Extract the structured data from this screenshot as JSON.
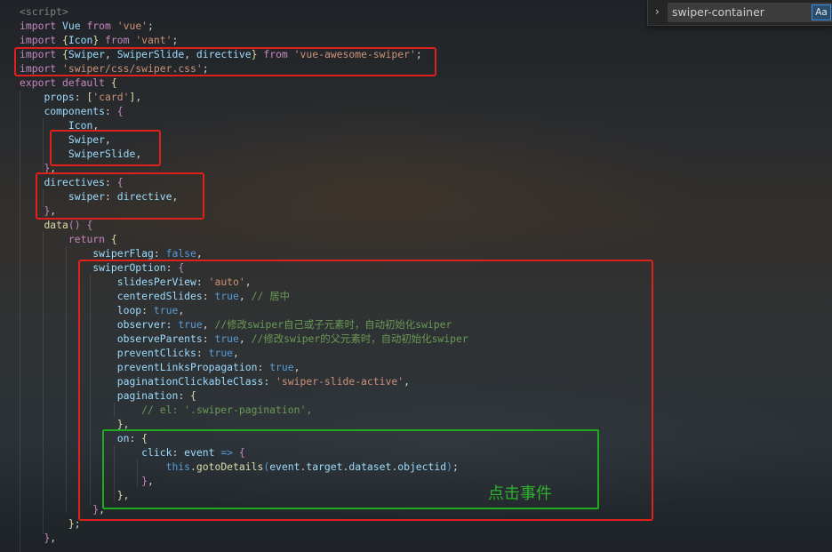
{
  "code_lines": [
    [
      [
        "tag",
        "<script>"
      ]
    ],
    [
      [
        "kw",
        "import "
      ],
      [
        "id",
        "Vue "
      ],
      [
        "kw",
        "from "
      ],
      [
        "str",
        "'vue'"
      ],
      [
        "punc",
        ";"
      ]
    ],
    [
      [
        "kw",
        "import "
      ],
      [
        "fn",
        "{"
      ],
      [
        "id",
        "Icon"
      ],
      [
        "fn",
        "} "
      ],
      [
        "kw",
        "from "
      ],
      [
        "str",
        "'vant'"
      ],
      [
        "punc",
        ";"
      ]
    ],
    [
      [
        "kw",
        "import "
      ],
      [
        "fn",
        "{"
      ],
      [
        "id",
        "Swiper"
      ],
      [
        "punc",
        ", "
      ],
      [
        "id",
        "SwiperSlide"
      ],
      [
        "punc",
        ", "
      ],
      [
        "id",
        "directive"
      ],
      [
        "fn",
        "} "
      ],
      [
        "kw",
        "from "
      ],
      [
        "str",
        "'vue-awesome-swiper'"
      ],
      [
        "punc",
        ";"
      ]
    ],
    [
      [
        "kw",
        "import "
      ],
      [
        "str",
        "'swiper/css/swiper.css'"
      ],
      [
        "punc",
        ";"
      ]
    ],
    [
      [
        "kw",
        "export default "
      ],
      [
        "fn",
        "{"
      ]
    ],
    [
      [
        "punc",
        "    "
      ],
      [
        "id",
        "props"
      ],
      [
        "punc",
        ": "
      ],
      [
        "fn",
        "["
      ],
      [
        "str",
        "'card'"
      ],
      [
        "fn",
        "]"
      ],
      [
        "punc",
        ","
      ]
    ],
    [
      [
        "punc",
        "    "
      ],
      [
        "id",
        "components"
      ],
      [
        "punc",
        ": "
      ],
      [
        "kw",
        "{"
      ]
    ],
    [
      [
        "punc",
        "        "
      ],
      [
        "id",
        "Icon"
      ],
      [
        "punc",
        ","
      ]
    ],
    [
      [
        "punc",
        "        "
      ],
      [
        "id",
        "Swiper"
      ],
      [
        "punc",
        ","
      ]
    ],
    [
      [
        "punc",
        "        "
      ],
      [
        "id",
        "SwiperSlide"
      ],
      [
        "punc",
        ","
      ]
    ],
    [
      [
        "punc",
        "    "
      ],
      [
        "kw",
        "}"
      ],
      [
        "punc",
        ","
      ]
    ],
    [
      [
        "punc",
        "    "
      ],
      [
        "id",
        "directives"
      ],
      [
        "punc",
        ": "
      ],
      [
        "kw",
        "{"
      ]
    ],
    [
      [
        "punc",
        "        "
      ],
      [
        "id",
        "swiper"
      ],
      [
        "punc",
        ": "
      ],
      [
        "id",
        "directive"
      ],
      [
        "punc",
        ","
      ]
    ],
    [
      [
        "punc",
        "    "
      ],
      [
        "kw",
        "}"
      ],
      [
        "punc",
        ","
      ]
    ],
    [
      [
        "punc",
        "    "
      ],
      [
        "fn",
        "data"
      ],
      [
        "kw",
        "() {"
      ]
    ],
    [
      [
        "punc",
        "        "
      ],
      [
        "kw",
        "return "
      ],
      [
        "fn",
        "{"
      ]
    ],
    [
      [
        "punc",
        "            "
      ],
      [
        "id",
        "swiperFlag"
      ],
      [
        "punc",
        ": "
      ],
      [
        "kw2",
        "false"
      ],
      [
        "punc",
        ","
      ]
    ],
    [
      [
        "punc",
        "            "
      ],
      [
        "id",
        "swiperOption"
      ],
      [
        "punc",
        ": "
      ],
      [
        "kw",
        "{"
      ]
    ],
    [
      [
        "punc",
        "                "
      ],
      [
        "id",
        "slidesPerView"
      ],
      [
        "punc",
        ": "
      ],
      [
        "str",
        "'auto'"
      ],
      [
        "punc",
        ","
      ]
    ],
    [
      [
        "punc",
        "                "
      ],
      [
        "id",
        "centeredSlides"
      ],
      [
        "punc",
        ": "
      ],
      [
        "kw2",
        "true"
      ],
      [
        "punc",
        ", "
      ],
      [
        "cm",
        "// 居中"
      ]
    ],
    [
      [
        "punc",
        "                "
      ],
      [
        "id",
        "loop"
      ],
      [
        "punc",
        ": "
      ],
      [
        "kw2",
        "true"
      ],
      [
        "punc",
        ","
      ]
    ],
    [
      [
        "punc",
        "                "
      ],
      [
        "id",
        "observer"
      ],
      [
        "punc",
        ": "
      ],
      [
        "kw2",
        "true"
      ],
      [
        "punc",
        ", "
      ],
      [
        "cm",
        "//修改swiper自己或子元素时，自动初始化swiper"
      ]
    ],
    [
      [
        "punc",
        "                "
      ],
      [
        "id",
        "observeParents"
      ],
      [
        "punc",
        ": "
      ],
      [
        "kw2",
        "true"
      ],
      [
        "punc",
        ", "
      ],
      [
        "cm",
        "//修改swiper的父元素时，自动初始化swiper"
      ]
    ],
    [
      [
        "punc",
        "                "
      ],
      [
        "id",
        "preventClicks"
      ],
      [
        "punc",
        ": "
      ],
      [
        "kw2",
        "true"
      ],
      [
        "punc",
        ","
      ]
    ],
    [
      [
        "punc",
        "                "
      ],
      [
        "id",
        "preventLinksPropagation"
      ],
      [
        "punc",
        ": "
      ],
      [
        "kw2",
        "true"
      ],
      [
        "punc",
        ","
      ]
    ],
    [
      [
        "punc",
        "                "
      ],
      [
        "id",
        "paginationClickableClass"
      ],
      [
        "punc",
        ": "
      ],
      [
        "str",
        "'swiper-slide-active'"
      ],
      [
        "punc",
        ","
      ]
    ],
    [
      [
        "punc",
        "                "
      ],
      [
        "id",
        "pagination"
      ],
      [
        "punc",
        ": "
      ],
      [
        "fn",
        "{"
      ]
    ],
    [
      [
        "punc",
        "                    "
      ],
      [
        "cm",
        "// el: '.swiper-pagination',"
      ]
    ],
    [
      [
        "punc",
        "                "
      ],
      [
        "fn",
        "}"
      ],
      [
        "punc",
        ","
      ]
    ],
    [
      [
        "punc",
        "                "
      ],
      [
        "id",
        "on"
      ],
      [
        "punc",
        ": "
      ],
      [
        "fn",
        "{"
      ]
    ],
    [
      [
        "punc",
        "                    "
      ],
      [
        "id",
        "click"
      ],
      [
        "punc",
        ": "
      ],
      [
        "id",
        "event "
      ],
      [
        "kw2",
        "=> "
      ],
      [
        "kw",
        "{"
      ]
    ],
    [
      [
        "punc",
        "                        "
      ],
      [
        "kw2",
        "this"
      ],
      [
        "punc",
        "."
      ],
      [
        "fn",
        "gotoDetails"
      ],
      [
        "kw2",
        "("
      ],
      [
        "id",
        "event"
      ],
      [
        "punc",
        "."
      ],
      [
        "id",
        "target"
      ],
      [
        "punc",
        "."
      ],
      [
        "id",
        "dataset"
      ],
      [
        "punc",
        "."
      ],
      [
        "id",
        "objectid"
      ],
      [
        "kw2",
        ")"
      ],
      [
        "punc",
        ";"
      ]
    ],
    [
      [
        "punc",
        "                    "
      ],
      [
        "kw",
        "}"
      ],
      [
        "punc",
        ","
      ]
    ],
    [
      [
        "punc",
        "                "
      ],
      [
        "fn",
        "}"
      ],
      [
        "punc",
        ","
      ]
    ],
    [
      [
        "punc",
        "            "
      ],
      [
        "kw",
        "}"
      ],
      [
        "punc",
        ","
      ]
    ],
    [
      [
        "punc",
        "        "
      ],
      [
        "fn",
        "}"
      ],
      [
        "punc",
        ";"
      ]
    ],
    [
      [
        "punc",
        "    "
      ],
      [
        "kw",
        "}"
      ],
      [
        "punc",
        ","
      ]
    ]
  ],
  "annotation": {
    "label": "点击事件"
  },
  "find_widget": {
    "query": "swiper-container",
    "case_toggle": "Aa"
  },
  "colors": {
    "highlight_box": "#e0201b",
    "note_box": "#1faa1f"
  }
}
